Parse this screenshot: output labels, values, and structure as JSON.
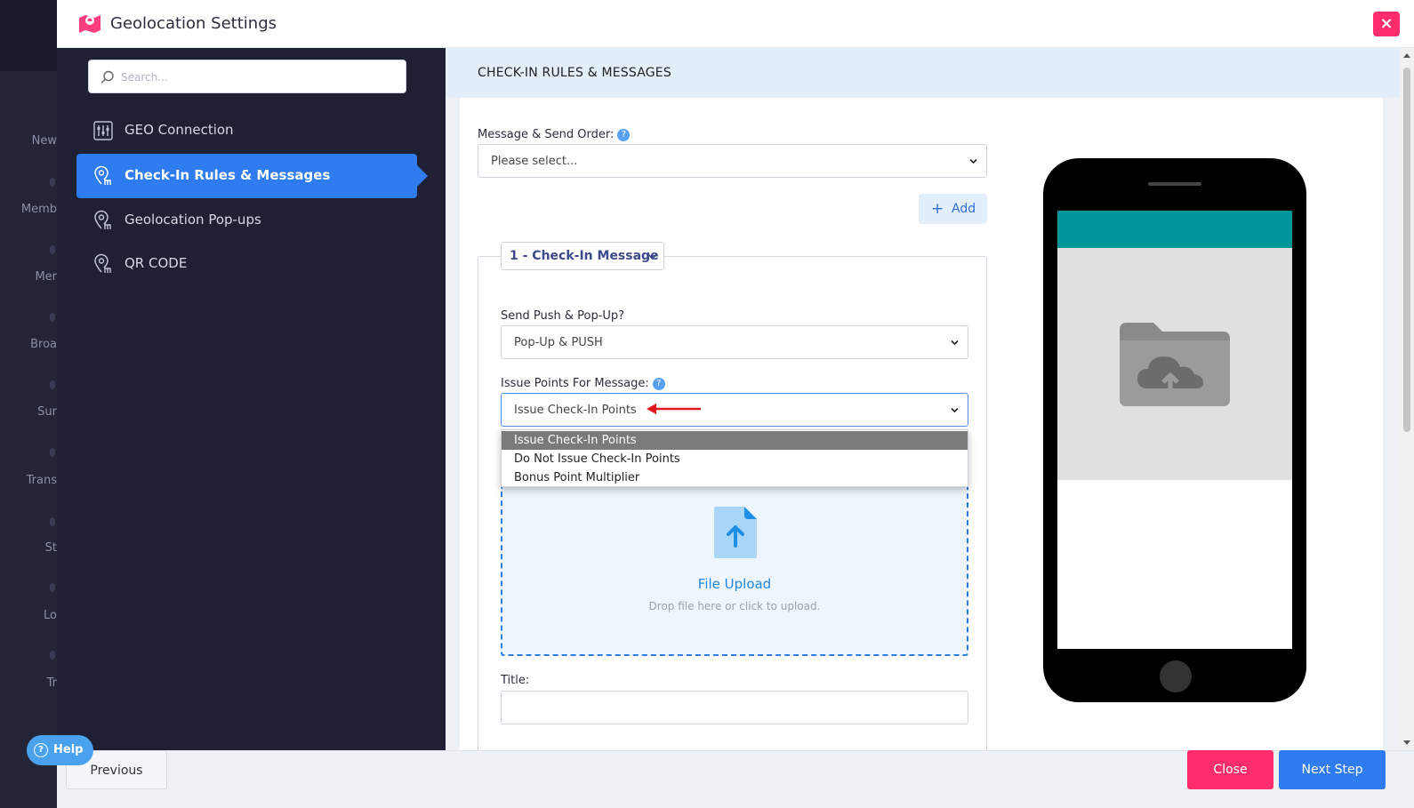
{
  "background_nav": {
    "items": [
      "New",
      "Memb",
      "Mer",
      "Broa",
      "Sur",
      "Trans",
      "St",
      "Lo",
      "Tr"
    ]
  },
  "modal": {
    "title": "Geolocation Settings",
    "close_label": "×"
  },
  "sidebar": {
    "search_placeholder": "Search...",
    "items": [
      {
        "label": "GEO Connection",
        "icon": "sliders-icon",
        "active": false
      },
      {
        "label": "Check-In Rules & Messages",
        "icon": "map-pin-icon",
        "active": true
      },
      {
        "label": "Geolocation Pop-ups",
        "icon": "map-pin-icon",
        "active": false
      },
      {
        "label": "QR CODE",
        "icon": "map-pin-icon",
        "active": false
      }
    ]
  },
  "section": {
    "heading": "CHECK-IN RULES & MESSAGES"
  },
  "form": {
    "send_order_label": "Message & Send Order:",
    "send_order_value": "Please select...",
    "add_label": "Add",
    "message_tab_label": "1 - Check-In Message",
    "send_push_label": "Send Push & Pop-Up?",
    "send_push_value": "Pop-Up & PUSH",
    "issue_points_label": "Issue Points For Message:",
    "issue_points_value": "Issue Check-In Points",
    "issue_points_options": [
      "Issue Check-In Points",
      "Do Not Issue Check-In Points",
      "Bonus Point Multiplier"
    ],
    "upload_title": "File Upload",
    "upload_subtitle": "Drop file here or click to upload.",
    "title_label": "Title:",
    "title_value": ""
  },
  "footer": {
    "previous_label": "Previous",
    "close_label": "Close",
    "next_label": "Next Step"
  },
  "help": {
    "label": "Help"
  },
  "colors": {
    "accent": "#2f7cf0",
    "danger": "#ff2d6b",
    "teal": "#00959a",
    "sidebar_bg": "#1f2033"
  }
}
